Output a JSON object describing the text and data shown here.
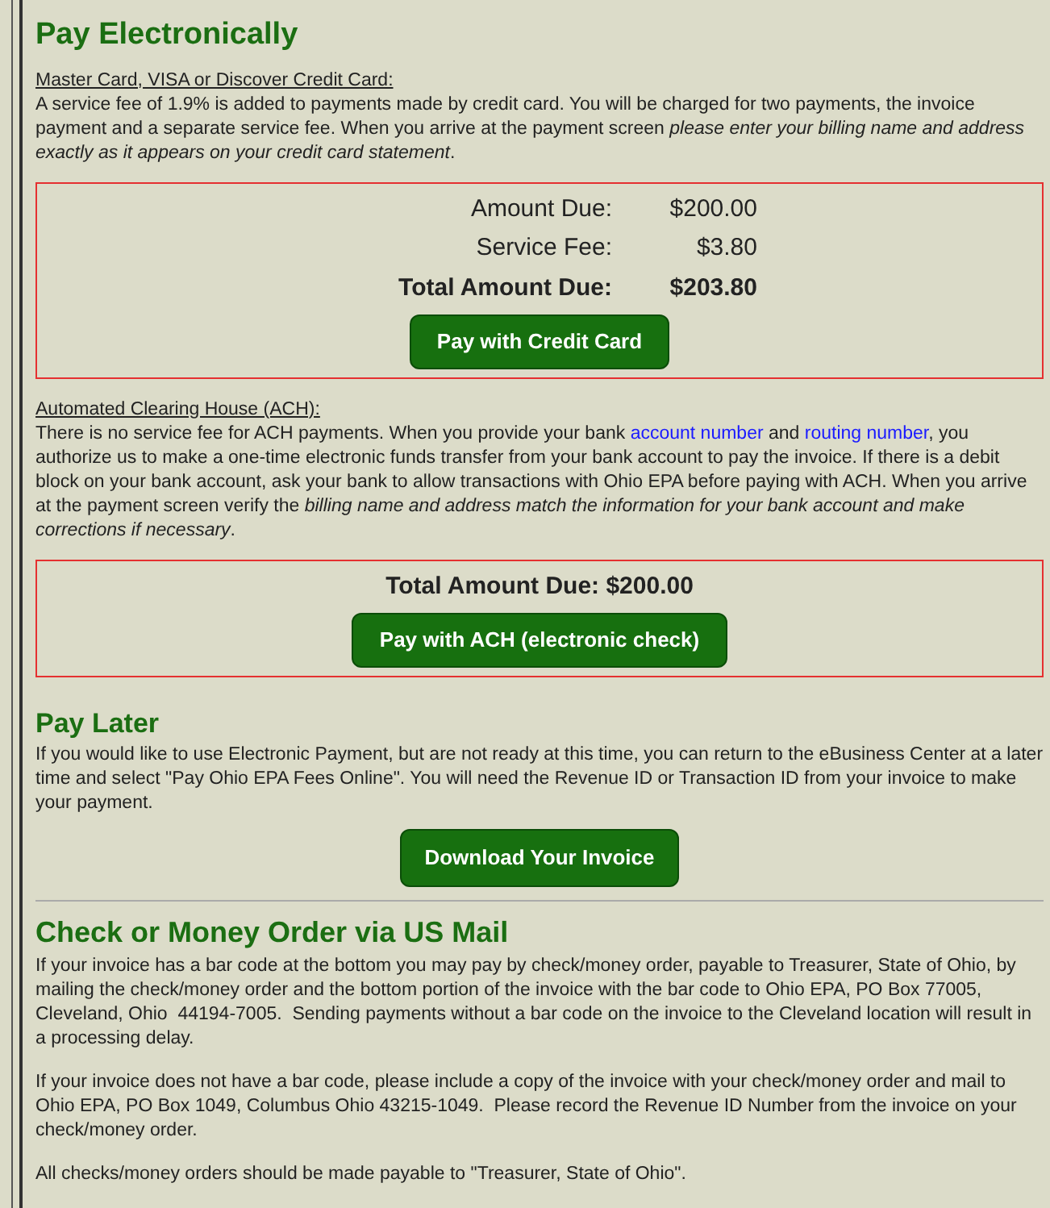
{
  "heading": "Pay Electronically",
  "methods": [
    {
      "label": "Master Card, VISA or Discover Credit Card:",
      "segments": [
        {
          "kind": "text",
          "text": "A service fee of 1.9% is added to payments made by credit card. You will be charged for two payments, the invoice payment and a separate service fee. When you arrive at the payment screen *please enter your billing name and address exactly as it appears on your credit card statement*."
        }
      ],
      "rows": [
        {
          "label": "Amount Due:",
          "value": "$200.00",
          "bold": false
        },
        {
          "label": "Service Fee:",
          "value": "$3.80",
          "bold": false
        },
        {
          "label": "Total Amount Due:",
          "value": "$203.80",
          "bold": true
        }
      ],
      "button": "Pay with Credit Card"
    },
    {
      "label": "Automated Clearing House (ACH):",
      "segments": [
        {
          "kind": "text",
          "text": "There is no service fee for ACH payments. When you provide your bank "
        },
        {
          "kind": "link",
          "text": "account number"
        },
        {
          "kind": "text",
          "text": " and "
        },
        {
          "kind": "link",
          "text": "routing number"
        },
        {
          "kind": "text",
          "text": ", you authorize us to make a one-time electronic funds transfer from your bank account to pay the invoice. If there is a debit block on your bank account, ask your bank to allow transactions with Ohio EPA before paying with ACH. When you arrive at the payment screen verify the *billing name and address match the information for your bank account and make corrections if necessary*."
        }
      ],
      "total": "Total Amount Due: $200.00",
      "button": "Pay with ACH (electronic check)"
    }
  ],
  "pay_later": {
    "heading": "Pay Later",
    "text": "If you would like to use Electronic Payment, but are not ready at this time, you can return to the eBusiness Center at a later time and select \"Pay Ohio EPA Fees Online\". You will need the Revenue ID or Transaction ID from your invoice to make your payment.",
    "button": "Download Your Invoice"
  },
  "mail": {
    "heading": "Check or Money Order via US Mail",
    "paragraphs": [
      "If your invoice has a bar code at the bottom you may pay by check/money order, payable to Treasurer, State of Ohio, by mailing the check/money order and the bottom portion of the invoice with the bar code to Ohio EPA, PO Box 77005, Cleveland, Ohio  44194-7005.  Sending payments without a bar code on the invoice to the Cleveland location will result in a processing delay.",
      "If your invoice does not have a bar code, please include a copy of the invoice with your check/money order and mail to Ohio EPA, PO Box 1049, Columbus Ohio 43215-1049.  Please record the Revenue ID Number from the invoice on your check/money order.",
      "All checks/money orders should be made payable to \"Treasurer, State of Ohio\"."
    ]
  }
}
